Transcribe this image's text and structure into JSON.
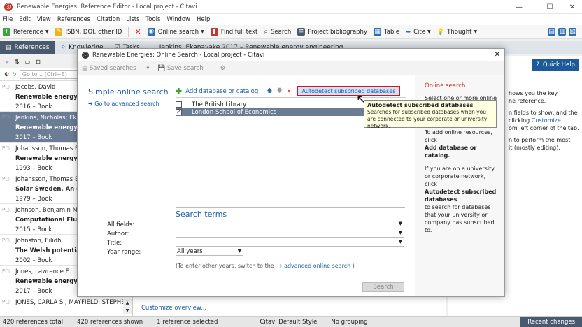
{
  "app": {
    "title": "Renewable Energies: Reference Editor - Local project - Citavi",
    "menu": [
      "File",
      "Edit",
      "View",
      "References",
      "Citation",
      "Lists",
      "Tools",
      "Window",
      "Help"
    ],
    "toolbar": {
      "reference": "Reference",
      "isbn": "ISBN, DOI, other ID",
      "online_search": "Online search",
      "find_full_text": "Find full text",
      "search": "Search",
      "project_bibliography": "Project bibliography",
      "table": "Table",
      "cite": "Cite",
      "thought": "Thought"
    },
    "tabs": [
      "References",
      "Knowledge",
      "Tasks"
    ],
    "goto_placeholder": "Go to... (Ctrl+E)",
    "center_header": "Jenkins, Ekanayake 2017 – Renewable energy engineering",
    "quick_help": "Quick Help",
    "customize_overview": "Customize overview...",
    "references": [
      {
        "author": "Jacobs, David",
        "title": "Renewable energy polic",
        "meta": "2016 – Book",
        "selected": false
      },
      {
        "author": "Jenkins, Nicholas; Ekanay",
        "title": "Renewable energy engi",
        "meta": "2017 – Book",
        "selected": true
      },
      {
        "author": "Johansson, Thomas B.",
        "title": "Renewable energy. Sou",
        "meta": "1993 – Book",
        "selected": false
      },
      {
        "author": "Johansson, Thomas B.; St",
        "title": "Solar Sweden. An outlin",
        "meta": "1979 – Book",
        "selected": false
      },
      {
        "author": "Johnson, Benjamin Micha",
        "title": "Computational Fluid Dyn",
        "meta": "2015 – Book",
        "selected": false
      },
      {
        "author": "Johnston, Eilidh.",
        "title": "The Welsh potential for",
        "meta": "2002 – Book",
        "selected": false
      },
      {
        "author": "Jones, Lawrence E.",
        "title": "Renewable energy integ",
        "meta": "2017 – Book",
        "selected": false
      },
      {
        "author": "JONES, CARLA S.; MAYFIELD, STEPHEN P.",
        "title": "",
        "meta": "",
        "selected": false
      }
    ],
    "right_pane": [
      "hows you the key",
      "he reference.",
      "n fields to show, and the",
      "clicking",
      "om left corner of the tab.",
      "n to perform the most",
      "it (mostly editing)."
    ],
    "right_pane_link": "Customize",
    "status": {
      "total": "420 references total",
      "shown": "420 references shown",
      "selected": "1 reference selected",
      "style": "Citavi Default Style",
      "grouping": "No grouping",
      "recent": "Recent changes"
    }
  },
  "dialog": {
    "title": "Renewable Energies: Online Search - Local project - Citavi",
    "tools": {
      "saved": "Saved searches",
      "save": "Save search"
    },
    "heading": "Simple online search",
    "advanced_link": "Go to advanced search",
    "add_db": "Add database or catalog",
    "autodetect": "Autodetect subscribed databases",
    "databases": [
      {
        "name": "The British Library",
        "checked": false
      },
      {
        "name": "London School of Economics",
        "checked": true
      }
    ],
    "tooltip": {
      "title": "Autodetect subscribed databases",
      "body": "Searches for subscribed databases when you are connected to your corporate or university network."
    },
    "search_terms": "Search terms",
    "fields": {
      "all": "All fields:",
      "author": "Author:",
      "title": "Title:",
      "year": "Year range:"
    },
    "year_value": "All years",
    "other_years_prefix": "(To enter other years, switch to the",
    "other_years_link": "advanced online search",
    "other_years_suffix": ")",
    "search_button": "Search",
    "side": {
      "title": "Online search",
      "p1": "Select one or more online",
      "p2": "To add online resources, click",
      "p2b": "Add database or catalog.",
      "p3": "If you are on a university or corporate network, click",
      "p3b": "Autodetect subscribed databases",
      "p3c": "to search for databases that your university or company has subscribed to."
    }
  },
  "colors": {
    "accent": "#1a5fa8",
    "highlight": "#e0101a",
    "selection": "#6b7d95"
  }
}
